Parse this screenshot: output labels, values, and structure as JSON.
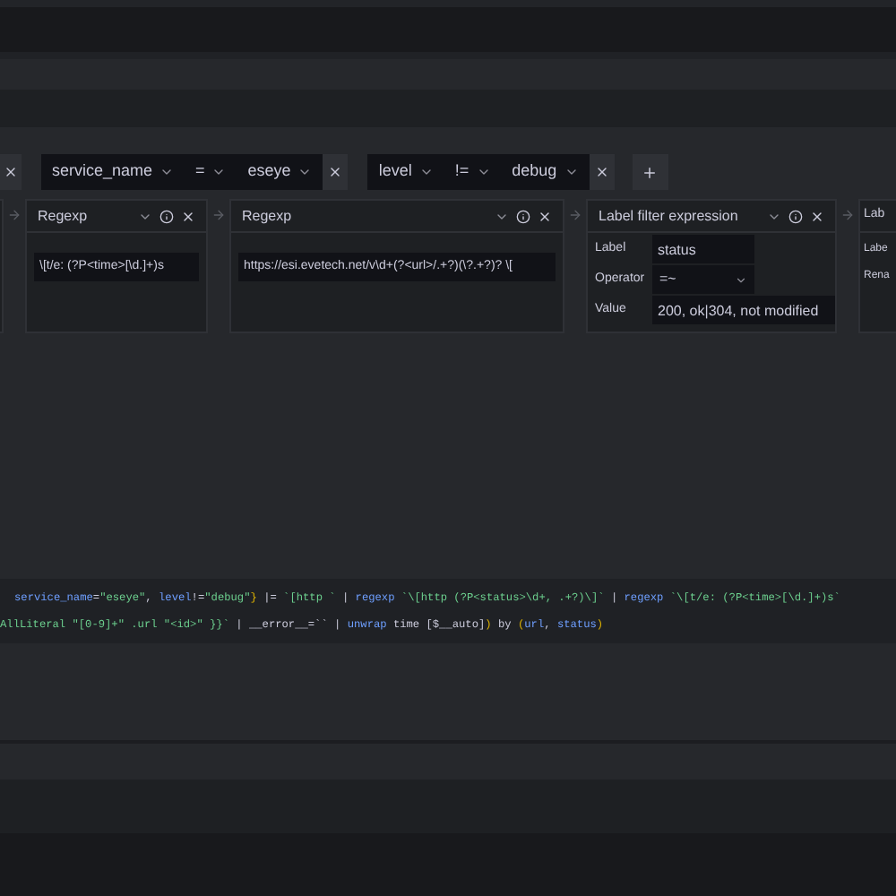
{
  "label_filters": [
    {
      "label": "service_name",
      "operator": "=",
      "value": "eseye"
    },
    {
      "label": "level",
      "operator": "!=",
      "value": "debug"
    }
  ],
  "operations": [
    {
      "kind": "regexp",
      "title": "Regexp",
      "expression": "\\[t/e: (?P<time>[\\d.]+)s"
    },
    {
      "kind": "regexp",
      "title": "Regexp",
      "expression": "https://esi.evetech.net/v\\d+(?<url>/.+?)(\\?.+?)? \\["
    },
    {
      "kind": "label_filter",
      "title": "Label filter expression",
      "fields": [
        {
          "kind": "text",
          "label": "Label",
          "value": "status"
        },
        {
          "kind": "select",
          "label": "Operator",
          "value": "=~"
        },
        {
          "kind": "text",
          "label": "Value",
          "value": "200, ok|304, not modified"
        }
      ]
    },
    {
      "kind": "cut",
      "title": "Lab",
      "field_labels": [
        "Labe",
        "Rena"
      ]
    }
  ],
  "query_lines": [
    [
      {
        "kind": "label",
        "text": "service_name"
      },
      {
        "kind": "punct",
        "text": "="
      },
      {
        "kind": "string",
        "text": "\"eseye\""
      },
      {
        "kind": "punct",
        "text": ", "
      },
      {
        "kind": "label",
        "text": "level"
      },
      {
        "kind": "punct",
        "text": "!="
      },
      {
        "kind": "string",
        "text": "\"debug\""
      },
      {
        "kind": "brace",
        "text": "}"
      },
      {
        "kind": "punct",
        "text": " |= "
      },
      {
        "kind": "string",
        "text": "`[http `"
      },
      {
        "kind": "punct",
        "text": " | "
      },
      {
        "kind": "keyword",
        "text": "regexp "
      },
      {
        "kind": "string",
        "text": "`\\[http (?P<status>\\d+, .+?)\\]`"
      },
      {
        "kind": "punct",
        "text": " | "
      },
      {
        "kind": "keyword",
        "text": "regexp "
      },
      {
        "kind": "string",
        "text": "`\\[t/e: (?P<time>[\\d.]+)s`"
      }
    ],
    [
      {
        "kind": "string",
        "text": "AllLiteral \"[0-9]+\" .url \"<id>\" }}`"
      },
      {
        "kind": "punct",
        "text": " | __error__=``"
      },
      {
        "kind": "punct",
        "text": " | "
      },
      {
        "kind": "keyword",
        "text": "unwrap"
      },
      {
        "kind": "punct",
        "text": " time [$__auto]"
      },
      {
        "kind": "brace",
        "text": ")"
      },
      {
        "kind": "punct",
        "text": " by "
      },
      {
        "kind": "brace",
        "text": "("
      },
      {
        "kind": "label",
        "text": "url"
      },
      {
        "kind": "punct",
        "text": ", "
      },
      {
        "kind": "label",
        "text": "status"
      },
      {
        "kind": "brace",
        "text": ")"
      }
    ]
  ]
}
